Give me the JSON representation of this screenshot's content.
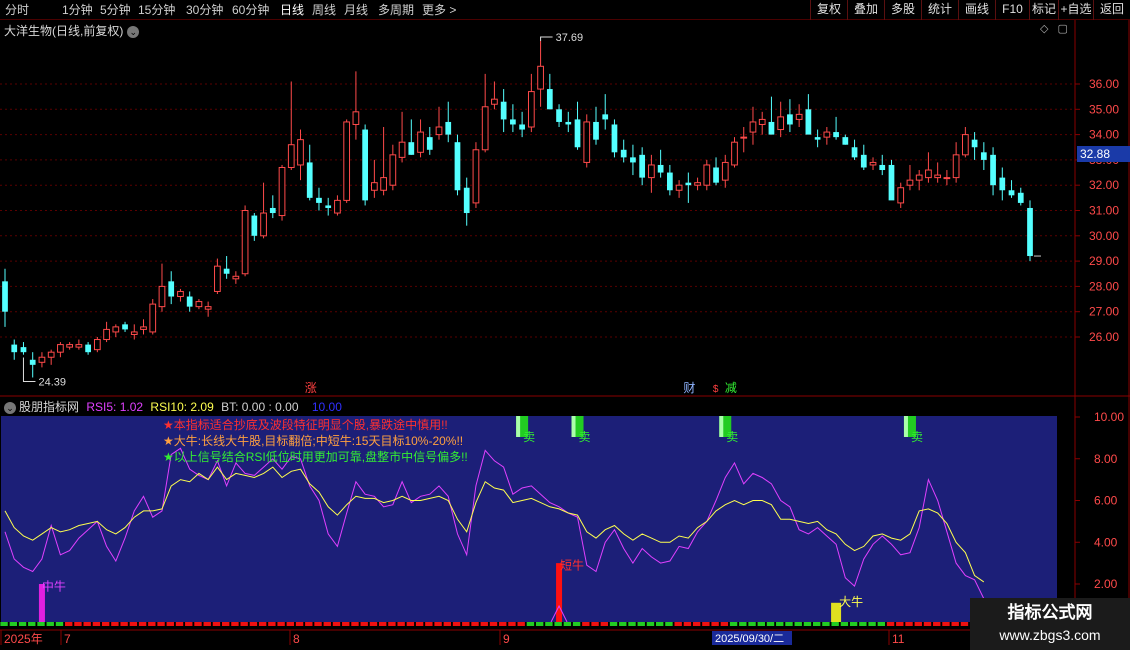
{
  "toolbar": {
    "periods": [
      "分时",
      "1分钟",
      "5分钟",
      "15分钟",
      "30分钟",
      "60分钟",
      "日线",
      "周线",
      "月线",
      "多周期",
      "更多 >"
    ],
    "active_period": "日线",
    "right_buttons": [
      "复权",
      "叠加",
      "多股",
      "统计",
      "画线",
      "F10",
      "标记",
      "+自选",
      "返回"
    ]
  },
  "main_chart": {
    "title": "大洋生物(日线,前复权)",
    "price_axis": [
      "36.00",
      "35.00",
      "34.00",
      "33.00",
      "32.00",
      "31.00",
      "30.00",
      "29.00",
      "28.00",
      "27.00",
      "26.00"
    ],
    "current_price": "32.88",
    "high_label": "37.69",
    "low_label": "24.39",
    "event_labels": [
      {
        "text": "涨",
        "color": "#ff4040"
      },
      {
        "text": "财",
        "color": "#8fb4ff"
      },
      {
        "text": "$",
        "color": "#ff4040"
      },
      {
        "text": "减",
        "color": "#33ee33"
      }
    ]
  },
  "indicator": {
    "name": "股朋指标网",
    "rsi5_label": "RSI5: 1.02",
    "rsi10_label": "RSI10: 2.09",
    "bt_label": "BT: 0.00 : 0.00",
    "extra_value": "10.00",
    "axis": [
      "10.00",
      "8.00",
      "6.00",
      "4.00",
      "2.00"
    ],
    "notes": [
      {
        "text": "★本指标适合抄底及波段特征明显个股,暴跌途中慎用!!",
        "color": "#ff3030"
      },
      {
        "text": "★大牛:长线大牛股,目标翻倍;中短牛:15天目标10%-20%!!",
        "color": "#ffa040"
      },
      {
        "text": "★以上信号结合RSI低位时用更加可靠,盘整市中信号偏多!!",
        "color": "#33ee33"
      }
    ],
    "sell_label": "卖",
    "signal_labels": {
      "zhong": "中牛",
      "duan": "短牛",
      "da": "大牛"
    }
  },
  "time_axis": {
    "labels": [
      "2025年",
      "7",
      "8",
      "9",
      "11"
    ],
    "cursor_date": "2025/09/30/二"
  },
  "colors": {
    "up": "#ff4a4a",
    "down": "#54ffff",
    "rsi5": "#e040ff",
    "rsi10": "#ffff50",
    "panel_bg": "#1c1f78",
    "grid": "#5a0000"
  },
  "chart_data": [
    {
      "type": "candlestick",
      "title": "大洋生物(日线,前复权)",
      "ylim": [
        24,
        38
      ],
      "candles": [
        [
          28.2,
          28.7,
          26.4,
          27.0
        ],
        [
          25.7,
          25.9,
          25.1,
          25.4
        ],
        [
          25.6,
          25.8,
          25.3,
          25.4
        ],
        [
          25.1,
          25.4,
          24.4,
          24.9
        ],
        [
          25.0,
          25.4,
          24.8,
          25.2
        ],
        [
          25.2,
          25.5,
          24.9,
          25.4
        ],
        [
          25.4,
          25.8,
          25.2,
          25.7
        ],
        [
          25.6,
          25.8,
          25.5,
          25.7
        ],
        [
          25.6,
          25.9,
          25.5,
          25.7
        ],
        [
          25.7,
          25.8,
          25.3,
          25.4
        ],
        [
          25.5,
          26.0,
          25.4,
          25.9
        ],
        [
          25.9,
          26.6,
          25.8,
          26.3
        ],
        [
          26.2,
          26.5,
          26.0,
          26.4
        ],
        [
          26.5,
          26.6,
          26.2,
          26.3
        ],
        [
          26.1,
          26.5,
          25.9,
          26.2
        ],
        [
          26.3,
          26.7,
          26.1,
          26.4
        ],
        [
          26.2,
          27.5,
          26.1,
          27.3
        ],
        [
          27.2,
          28.9,
          27.0,
          28.0
        ],
        [
          28.2,
          28.6,
          27.3,
          27.6
        ],
        [
          27.6,
          27.9,
          27.4,
          27.8
        ],
        [
          27.6,
          27.8,
          27.0,
          27.2
        ],
        [
          27.2,
          27.5,
          27.1,
          27.4
        ],
        [
          27.1,
          27.4,
          26.8,
          27.2
        ],
        [
          27.8,
          29.1,
          27.7,
          28.8
        ],
        [
          28.7,
          29.2,
          28.3,
          28.5
        ],
        [
          28.3,
          28.6,
          28.1,
          28.4
        ],
        [
          28.5,
          31.2,
          28.4,
          31.0
        ],
        [
          30.8,
          30.9,
          29.8,
          30.0
        ],
        [
          30.0,
          32.1,
          29.9,
          30.9
        ],
        [
          31.1,
          31.6,
          30.7,
          30.9
        ],
        [
          30.8,
          32.8,
          30.6,
          32.7
        ],
        [
          32.7,
          36.1,
          32.6,
          33.6
        ],
        [
          32.8,
          34.2,
          32.2,
          33.8
        ],
        [
          32.9,
          33.6,
          31.4,
          31.5
        ],
        [
          31.5,
          31.9,
          31.0,
          31.3
        ],
        [
          31.2,
          31.5,
          30.8,
          31.1
        ],
        [
          30.9,
          31.6,
          30.8,
          31.4
        ],
        [
          31.4,
          34.6,
          31.3,
          34.5
        ],
        [
          34.4,
          36.5,
          33.8,
          34.9
        ],
        [
          34.2,
          34.4,
          31.2,
          31.4
        ],
        [
          31.8,
          33.0,
          31.5,
          32.1
        ],
        [
          31.8,
          34.3,
          31.6,
          32.3
        ],
        [
          32.0,
          33.6,
          31.8,
          33.2
        ],
        [
          33.1,
          34.9,
          32.9,
          33.7
        ],
        [
          33.7,
          34.6,
          33.2,
          33.2
        ],
        [
          33.3,
          34.6,
          33.1,
          34.1
        ],
        [
          33.9,
          34.3,
          33.2,
          33.4
        ],
        [
          34.0,
          35.1,
          33.8,
          34.3
        ],
        [
          34.5,
          35.3,
          33.7,
          34.0
        ],
        [
          33.7,
          34.0,
          31.6,
          31.8
        ],
        [
          31.9,
          32.3,
          30.4,
          30.9
        ],
        [
          31.3,
          33.7,
          31.1,
          33.4
        ],
        [
          33.4,
          36.4,
          33.3,
          35.1
        ],
        [
          35.2,
          36.1,
          35.0,
          35.4
        ],
        [
          35.3,
          35.8,
          34.1,
          34.6
        ],
        [
          34.6,
          35.2,
          34.1,
          34.4
        ],
        [
          34.4,
          34.9,
          33.9,
          34.2
        ],
        [
          34.3,
          36.4,
          34.1,
          35.7
        ],
        [
          35.8,
          37.7,
          35.1,
          36.7
        ],
        [
          35.8,
          36.4,
          35.0,
          35.0
        ],
        [
          35.0,
          35.2,
          34.3,
          34.5
        ],
        [
          34.5,
          34.9,
          34.1,
          34.4
        ],
        [
          34.6,
          35.3,
          33.4,
          33.5
        ],
        [
          32.9,
          34.8,
          32.7,
          34.5
        ],
        [
          34.5,
          35.1,
          33.6,
          33.8
        ],
        [
          34.8,
          35.6,
          34.2,
          34.6
        ],
        [
          34.4,
          34.6,
          33.1,
          33.3
        ],
        [
          33.4,
          33.8,
          32.9,
          33.1
        ],
        [
          33.1,
          33.6,
          32.4,
          32.9
        ],
        [
          33.2,
          33.5,
          32.0,
          32.3
        ],
        [
          32.3,
          33.2,
          31.7,
          32.8
        ],
        [
          32.8,
          33.4,
          32.3,
          32.5
        ],
        [
          32.5,
          32.8,
          31.6,
          31.8
        ],
        [
          31.8,
          32.2,
          31.5,
          32.0
        ],
        [
          32.1,
          32.5,
          31.3,
          32.0
        ],
        [
          32.0,
          32.3,
          31.8,
          32.1
        ],
        [
          32.0,
          33.0,
          31.8,
          32.8
        ],
        [
          32.7,
          33.1,
          32.0,
          32.1
        ],
        [
          32.2,
          33.2,
          31.9,
          32.9
        ],
        [
          32.8,
          33.9,
          32.7,
          33.7
        ],
        [
          33.9,
          34.3,
          33.3,
          33.9
        ],
        [
          34.1,
          35.1,
          33.6,
          34.5
        ],
        [
          34.4,
          34.9,
          34.0,
          34.6
        ],
        [
          34.5,
          35.5,
          34.2,
          34.0
        ],
        [
          34.2,
          35.3,
          33.9,
          34.7
        ],
        [
          34.8,
          35.4,
          34.1,
          34.4
        ],
        [
          34.6,
          35.2,
          34.3,
          34.8
        ],
        [
          35.0,
          35.6,
          34.5,
          34.0
        ],
        [
          33.9,
          34.2,
          33.5,
          33.8
        ],
        [
          33.9,
          34.3,
          33.6,
          34.1
        ],
        [
          34.1,
          34.7,
          33.8,
          33.9
        ],
        [
          33.9,
          34.0,
          33.6,
          33.6
        ],
        [
          33.5,
          33.8,
          33.0,
          33.1
        ],
        [
          33.2,
          33.6,
          32.6,
          32.7
        ],
        [
          32.8,
          33.1,
          32.6,
          32.9
        ],
        [
          32.8,
          33.2,
          32.4,
          32.6
        ],
        [
          32.8,
          33.0,
          31.9,
          31.4
        ],
        [
          31.3,
          32.1,
          31.1,
          31.9
        ],
        [
          32.0,
          32.8,
          31.8,
          32.2
        ],
        [
          32.2,
          32.6,
          31.8,
          32.4
        ],
        [
          32.3,
          33.3,
          32.1,
          32.6
        ],
        [
          32.3,
          32.9,
          32.1,
          32.4
        ],
        [
          32.3,
          32.6,
          32.0,
          32.3
        ],
        [
          32.3,
          33.7,
          32.1,
          33.2
        ],
        [
          33.2,
          34.3,
          33.1,
          34.0
        ],
        [
          33.8,
          34.1,
          33.0,
          33.5
        ],
        [
          33.3,
          33.7,
          32.6,
          33.0
        ],
        [
          33.2,
          33.5,
          31.6,
          32.0
        ],
        [
          32.3,
          32.7,
          31.4,
          31.8
        ],
        [
          31.8,
          32.2,
          31.5,
          31.6
        ],
        [
          31.7,
          31.9,
          31.2,
          31.3
        ],
        [
          31.1,
          31.4,
          29.0,
          29.2
        ]
      ]
    },
    {
      "type": "line",
      "title": "股朋指标网",
      "ylim": [
        0,
        10.5
      ],
      "series": [
        {
          "name": "RSI5",
          "values": [
            4.5,
            3.2,
            2.8,
            2.6,
            3.2,
            4.8,
            3.4,
            3.6,
            4.2,
            4.6,
            5.0,
            3.8,
            3.1,
            4.2,
            5.5,
            6.2,
            5.2,
            5.5,
            8.2,
            8.5,
            7.5,
            7.2,
            7.0,
            7.9,
            6.7,
            7.8,
            7.3,
            7.2,
            7.6,
            8.0,
            7.5,
            8.1,
            8.0,
            6.7,
            6.0,
            4.4,
            3.8,
            5.4,
            6.9,
            6.3,
            6.2,
            5.7,
            5.8,
            6.9,
            5.9,
            6.2,
            6.3,
            6.7,
            6.2,
            4.4,
            3.4,
            6.7,
            8.4,
            7.9,
            7.6,
            6.3,
            6.6,
            6.7,
            6.3,
            5.9,
            5.7,
            5.4,
            5.2,
            2.9,
            2.6,
            4.0,
            4.6,
            3.7,
            3.0,
            3.7,
            3.3,
            3.0,
            3.1,
            3.8,
            3.7,
            4.5,
            5.0,
            6.0,
            7.1,
            7.8,
            6.8,
            7.3,
            7.1,
            6.8,
            6.0,
            5.7,
            4.6,
            4.4,
            4.7,
            4.3,
            3.9,
            2.3,
            1.9,
            3.2,
            3.9,
            4.3,
            3.9,
            3.4,
            3.5,
            4.7,
            7.0,
            6.0,
            4.5,
            3.0,
            2.4,
            2.2,
            1.3
          ]
        },
        {
          "name": "RSI10",
          "values": [
            5.5,
            4.7,
            4.3,
            4.1,
            4.4,
            4.7,
            4.5,
            4.6,
            4.8,
            4.9,
            5.0,
            4.6,
            4.4,
            4.7,
            5.2,
            5.5,
            5.5,
            5.6,
            6.7,
            7.0,
            6.9,
            7.3,
            7.0,
            7.6,
            7.0,
            7.3,
            7.2,
            7.1,
            7.3,
            7.6,
            7.1,
            7.4,
            7.5,
            6.8,
            6.4,
            5.7,
            5.3,
            5.8,
            6.2,
            6.1,
            6.1,
            5.9,
            6.0,
            6.2,
            6.0,
            6.0,
            6.1,
            6.2,
            6.0,
            5.1,
            4.5,
            5.9,
            6.9,
            6.6,
            6.5,
            5.9,
            6.0,
            6.1,
            5.9,
            5.7,
            5.6,
            5.4,
            5.3,
            4.5,
            4.2,
            4.6,
            4.8,
            4.4,
            4.1,
            4.4,
            4.2,
            4.0,
            4.0,
            4.3,
            4.2,
            4.7,
            5.0,
            5.5,
            5.8,
            6.0,
            5.8,
            6.0,
            6.0,
            5.8,
            5.1,
            5.1,
            5.0,
            4.9,
            5.0,
            4.6,
            4.4,
            3.9,
            3.6,
            3.8,
            4.3,
            4.4,
            4.2,
            4.1,
            4.4,
            5.5,
            5.6,
            5.4,
            4.9,
            4.0,
            3.5,
            2.4,
            2.1
          ]
        }
      ]
    }
  ]
}
